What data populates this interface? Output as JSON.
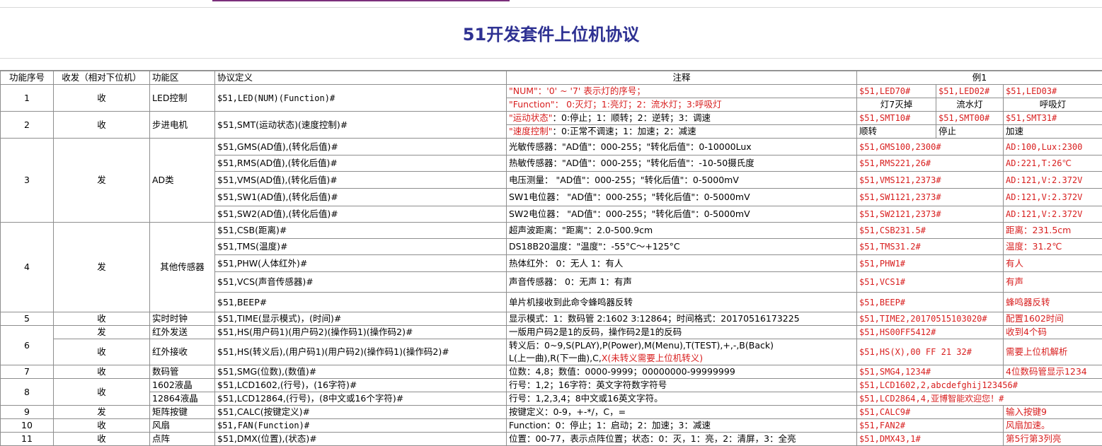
{
  "title": "51开发套件上位机协议",
  "headers": [
    "功能序号",
    "收发（相对下位机）",
    "功能区",
    "协议定义",
    "注释",
    "例1"
  ],
  "rows": {
    "r1": {
      "no": "1",
      "dir": "收",
      "area": "LED控制",
      "proto": "$51,LED(NUM)(Function)#",
      "note1": "\"NUM\"：'0' ~ '7' 表示灯的序号；",
      "note2": "\"Function\"： 0:灭灯；1:亮灯；2：流水灯；3:呼吸灯",
      "ex1": "$51,LED70#",
      "ex2": "$51,LED02#",
      "ex3": "$51,LED03#",
      "exd1": "灯7灭掉",
      "exd2": "流水灯",
      "exd3": "呼吸灯"
    },
    "r2": {
      "no": "2",
      "dir": "收",
      "area": "步进电机",
      "proto": "$51,SMT(运动状态)(速度控制)#",
      "note1a": "\"运动状态\"",
      "note1b": "：0:停止；1：顺转；2：逆转；3：调速",
      "note2a": "\"速度控制\"",
      "note2b": "：0:正常不调速；1：加速；2：减速",
      "ex1": "$51,SMT10#",
      "ex2": "$51,SMT00#",
      "ex3": "$51,SMT31#",
      "exd1": "顺转",
      "exd2": "停止",
      "exd3": "加速"
    },
    "r3": {
      "no": "3",
      "dir": "发",
      "area": "AD类",
      "items": [
        {
          "proto": "$51,GMS(AD值),(转化后值)#",
          "note": "光敏传感器：\"AD值\"：000-255；\"转化后值\"：0-10000Lux",
          "ex": "$51,GMS100,2300#",
          "res": "AD:100,Lux:2300"
        },
        {
          "proto": "$51,RMS(AD值),(转化后值)#",
          "note": "热敏传感器：\"AD值\"：000-255；\"转化后值\"：-10-50摄氏度",
          "ex": "$51,RMS221,26#",
          "res": "AD:221,T:26℃"
        },
        {
          "proto": "$51,VMS(AD值),(转化后值)#",
          "note": "电压测量：  \"AD值\"：000-255；\"转化后值\"：0-5000mV",
          "ex": "$51,VMS121,2373#",
          "res": "AD:121,V:2.372V"
        },
        {
          "proto": "$51,SW1(AD值),(转化后值)#",
          "note": "SW1电位器： \"AD值\"：000-255；\"转化后值\"：0-5000mV",
          "ex": "$51,SW1121,2373#",
          "res": "AD:121,V:2.372V"
        },
        {
          "proto": "$51,SW2(AD值),(转化后值)#",
          "note": "SW2电位器： \"AD值\"：000-255；\"转化后值\"：0-5000mV",
          "ex": "$51,SW2121,2373#",
          "res": "AD:121,V:2.372V"
        }
      ]
    },
    "r4": {
      "no": "4",
      "dir": "发",
      "area": "其他传感器",
      "items": [
        {
          "proto": "$51,CSB(距离)#",
          "note": "超声波距离：\"距离\"：2.0-500.9cm",
          "ex": "$51,CSB231.5#",
          "res": "距离：231.5cm"
        },
        {
          "proto": "$51,TMS(温度)#",
          "note": "DS18B20温度：\"温度\"：-55°C～+125°C",
          "ex": "$51,TMS31.2#",
          "res": "温度：31.2℃"
        },
        {
          "proto": "$51,PHW(人体红外)#",
          "note": "热体红外： 0：无人 1：有人",
          "ex": "$51,PHW1#",
          "res": "有人"
        },
        {
          "proto": "$51,VCS(声音传感器)#",
          "note": "声音传感器： 0：无声 1：有声",
          "ex": "$51,VCS1#",
          "res": "有声"
        },
        {
          "proto": "$51,BEEP#",
          "note": "单片机接收到此命令蜂鸣器反转",
          "ex": "$51,BEEP#",
          "res": "蜂鸣器反转"
        }
      ]
    },
    "r5": {
      "no": "5",
      "dir": "收",
      "area": "实时时钟",
      "proto": "$51,TIME(显示模式)，(时间)#",
      "note": "显示模式：1：数码管 2:1602 3:12864；时间格式：20170516173225",
      "ex": "$51,TIME2,20170515103020#",
      "res": "配置1602时间"
    },
    "r6": {
      "no": "6",
      "dir1": "发",
      "dir2": "收",
      "area1": "红外发送",
      "area2": "红外接收",
      "proto1": "$51,HS(用户码1)(用户码2)(操作码1)(操作码2)#",
      "proto2": "$51,HS(转义后),(用户码1)(用户码2)(操作码1)(操作码2)#",
      "note1": "一版用户码2是1的反码，操作码2是1的反码",
      "note2": "转义后：0~9,S(PLAY),P(Power),M(Menu),T(TEST),+,-,B(Back)",
      "note3a": "L(上一曲),R(下一曲),C,",
      "note3b": "X(未转义需要上位机转义)",
      "ex1": "$51,HS00FF5412#",
      "res1": "收到4个码",
      "ex2": "$51,HS(X),00 FF 21 32#",
      "res2": "需要上位机解析"
    },
    "r7": {
      "no": "7",
      "dir": "收",
      "area": "数码管",
      "proto": "$51,SMG(位数),(数值)#",
      "note": "位数：4,8；数值：0000-9999；00000000-99999999",
      "ex": "$51,SMG4,1234#",
      "res": "4位数码管显示1234"
    },
    "r8": {
      "no": "8",
      "dir": "收",
      "area1": "1602液晶",
      "area2": "12864液晶",
      "proto1": "$51,LCD1602,(行号)，(16字符)#",
      "proto2": "$51,LCD12864,(行号)，(8中文或16个字符)#",
      "note1": "行号：1,2；16字符：英文字符数字符号",
      "note2": "行号：1,2,3,4；8中文或16英文字符。",
      "ex1": "$51,LCD1602,2,abcdefghij123456#",
      "ex2": "$51,LCD2864,4,亚博智能欢迎您！#"
    },
    "r9": {
      "no": "9",
      "dir": "发",
      "area": "矩阵按键",
      "proto": "$51,CALC(按键定义)#",
      "note": "按键定义：0-9，+-*/，C，=",
      "ex": "$51,CALC9#",
      "res": "输入按键9"
    },
    "r10": {
      "no": "10",
      "dir": "收",
      "area": "风扇",
      "proto": "$51,FAN(Function)#",
      "note": "Function：0：停止；1：启动；2：加速；3：减速",
      "ex": "$51,FAN2#",
      "res": "风扇加速。"
    },
    "r11": {
      "no": "11",
      "dir": "收",
      "area": "点阵",
      "proto": "$51,DMX(位置),(状态)#",
      "note": "位置：00-77，表示点阵位置；状态：0：灭，1：亮，2：清屏，3：全亮",
      "ex": "$51,DMX43,1#",
      "res": "第5行第3列亮"
    }
  }
}
